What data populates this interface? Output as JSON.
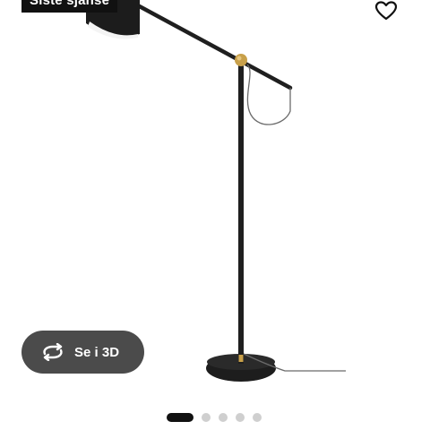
{
  "badge": {
    "label": "Siste sjanse"
  },
  "favorite": {
    "icon": "heart-icon"
  },
  "view3d": {
    "icon": "rotate-3d-icon",
    "label": "Se i 3D"
  },
  "gallery": {
    "slide_count": 5,
    "active_index": 0
  },
  "product_image": {
    "subject": "floor-lamp"
  },
  "colors": {
    "badge_bg": "#111111",
    "button_bg": "#4b4b4b",
    "dot_active": "#111111",
    "dot_inactive": "#cfcfcf",
    "brass": "#c8a04a"
  }
}
